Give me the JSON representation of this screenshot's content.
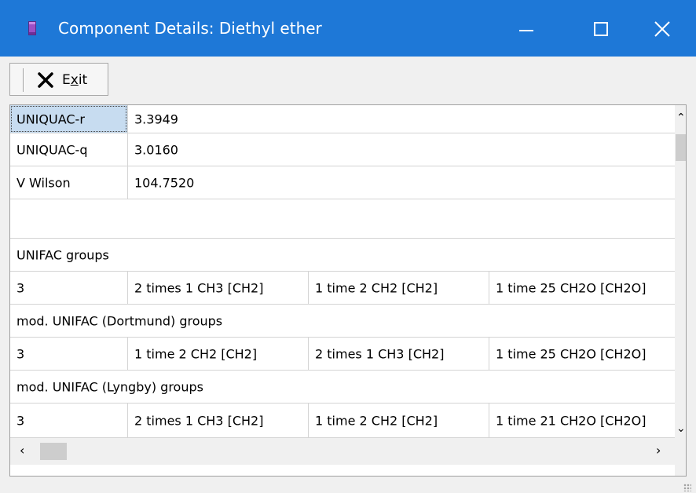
{
  "window": {
    "title": "Component Details: Diethyl ether",
    "app_icon": "purple-bar-icon",
    "accent_color": "#1e78d7"
  },
  "controls": {
    "minimize_icon": "minimize-icon",
    "maximize_icon": "maximize-icon",
    "close_icon": "close-icon"
  },
  "toolbar": {
    "exit_label_pre": "E",
    "exit_label_u": "x",
    "exit_label_post": "it",
    "exit_icon": "x-icon"
  },
  "grid": {
    "rows": [
      {
        "cells": [
          "UNIQUAC-r",
          "3.3949"
        ],
        "selected_col": 0
      },
      {
        "cells": [
          "UNIQUAC-q",
          "3.0160"
        ]
      },
      {
        "cells": [
          "V Wilson",
          "104.7520"
        ]
      },
      {
        "cells": [
          ""
        ]
      },
      {
        "cells": [
          "UNIFAC groups"
        ]
      },
      {
        "cells": [
          "3",
          "2 times 1 CH3 [CH2]",
          "1 time 2 CH2 [CH2]",
          "1 time 25 CH2O [CH2O]"
        ]
      },
      {
        "cells": [
          "mod. UNIFAC (Dortmund) groups"
        ]
      },
      {
        "cells": [
          "3",
          "1 time 2 CH2 [CH2]",
          "2 times 1 CH3 [CH2]",
          "1 time 25 CH2O [CH2O]"
        ]
      },
      {
        "cells": [
          "mod. UNIFAC (Lyngby) groups"
        ]
      },
      {
        "cells": [
          "3",
          "2 times 1 CH3 [CH2]",
          "1 time 2 CH2 [CH2]",
          "1 time 21 CH2O [CH2O]"
        ]
      }
    ],
    "scroll": {
      "up_icon": "chevron-up-icon",
      "down_icon": "chevron-down-icon",
      "left_icon": "chevron-left-icon",
      "right_icon": "chevron-right-icon"
    }
  }
}
